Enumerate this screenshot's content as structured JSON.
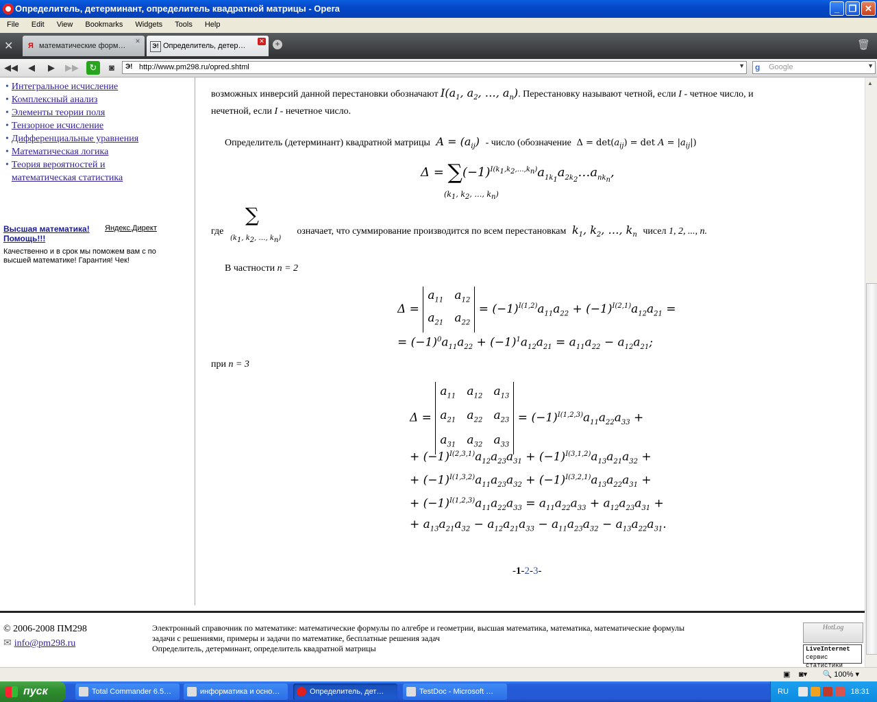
{
  "window": {
    "title": "Определитель, детерминант, определитель квадратной матрицы - Opera",
    "minimize": "_",
    "maximize": "❐",
    "close": "✕"
  },
  "menu": [
    "File",
    "Edit",
    "View",
    "Bookmarks",
    "Widgets",
    "Tools",
    "Help"
  ],
  "tabs": [
    {
      "label": "математические форм…",
      "icon": "Я"
    },
    {
      "label": "Определитель, детер…",
      "icon": "Э!"
    }
  ],
  "address": {
    "url": "http://www.pm298.ru/opred.shtml",
    "search_placeholder": "Google"
  },
  "sidebar": {
    "links": [
      "Интегральное исчисление",
      "Комплексный анализ",
      "Элементы теории поля",
      "Тензорное исчисление",
      "Дифференциальные уравнения",
      "Математическая логика",
      "Теория вероятностей и",
      "математическая статистика"
    ],
    "ad": {
      "headline": "Высшая математика! Помощь!!!",
      "source": "Яндекс.Директ",
      "text": "Качественно и в срок мы поможем вам с по высшей математике! Гарантия! Чек!"
    }
  },
  "article": {
    "p1a": "возможных инверсий данной перестановки обозначают",
    "p1b": ". Перестановку называют четной, если",
    "p1c": "- четное число, и",
    "p1d": "нечетной, если",
    "p1e": "- нечетное число.",
    "I": "I",
    "p2a": "Определитель (детерминант) квадратной матрицы",
    "p2b": "- число (обозначение",
    "p3a": "где",
    "p3b": "означает, что суммирование производится по всем перестановкам",
    "p3c": "чисел",
    "p3d": "1, 2, ..., n.",
    "p4a": "В частности",
    "p4b": "n = 2",
    "p5a": "при",
    "p5b": "n = 3"
  },
  "pager": {
    "prefix": "-",
    "current": "1",
    "sep1": "-",
    "p2": "2",
    "sep2": "-",
    "p3": "3",
    "suffix": "-"
  },
  "footer": {
    "copyright": "© 2006-2008 ПМ298",
    "email": "info@pm298.ru",
    "desc1": "Электронный справочник по математике: математические формулы по алгебре и геометрии, высшая математика, математика, математические формулы",
    "desc2": "задачи с решениями, примеры и задачи по математике, бесплатные решения задач",
    "desc3": "Определитель, детерминант, определитель квадратной матрицы",
    "counter1": "HotLog",
    "counter2a": "LiveInternet",
    "counter2b": "сервис статистики"
  },
  "status": {
    "zoom": "100%"
  },
  "taskbar": {
    "start": "пуск",
    "items": [
      "Total Commander 6.5…",
      "информатика и осно…",
      "Определитель, дет…",
      "TestDoc - Microsoft …"
    ],
    "lang": "RU",
    "clock": "18:31"
  }
}
